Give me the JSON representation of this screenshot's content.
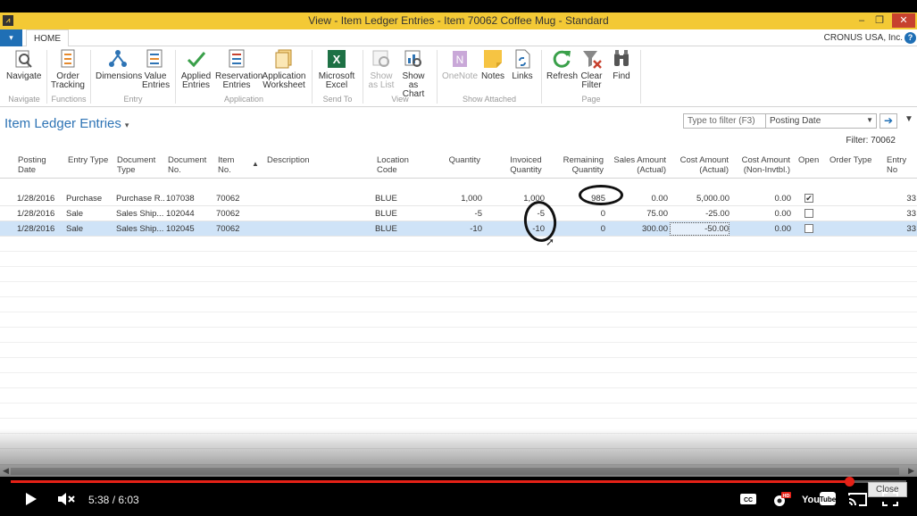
{
  "window": {
    "title": "View - Item Ledger Entries - Item 70062 Coffee Mug - Standard",
    "logo_icon": "dynamics-logo-icon"
  },
  "tabs": {
    "file_label": "▾",
    "home_label": "HOME",
    "company": "CRONUS USA, Inc.",
    "help": "?"
  },
  "ribbon": {
    "buttons": [
      {
        "label1": "Navigate",
        "label2": "",
        "icon": "navigate-icon"
      },
      {
        "label1": "Order",
        "label2": "Tracking",
        "icon": "order-tracking-icon"
      },
      {
        "label1": "Dimensions",
        "label2": "",
        "icon": "dimensions-icon"
      },
      {
        "label1": "Value",
        "label2": "Entries",
        "icon": "value-entries-icon"
      },
      {
        "label1": "Applied",
        "label2": "Entries",
        "icon": "checkmark-icon"
      },
      {
        "label1": "Reservation",
        "label2": "Entries",
        "icon": "reservation-entries-icon"
      },
      {
        "label1": "Application",
        "label2": "Worksheet",
        "icon": "application-worksheet-icon"
      },
      {
        "label1": "Microsoft",
        "label2": "Excel",
        "icon": "excel-icon"
      },
      {
        "label1": "Show",
        "label2": "as List",
        "icon": "show-as-list-icon"
      },
      {
        "label1": "Show as",
        "label2": "Chart",
        "icon": "show-as-chart-icon"
      },
      {
        "label1": "OneNote",
        "label2": "",
        "icon": "onenote-icon"
      },
      {
        "label1": "Notes",
        "label2": "",
        "icon": "notes-icon"
      },
      {
        "label1": "Links",
        "label2": "",
        "icon": "links-icon"
      },
      {
        "label1": "Refresh",
        "label2": "",
        "icon": "refresh-icon"
      },
      {
        "label1": "Clear",
        "label2": "Filter",
        "icon": "clear-filter-icon"
      },
      {
        "label1": "Find",
        "label2": "",
        "icon": "find-icon"
      }
    ],
    "groups": [
      "Navigate",
      "Functions",
      "Entry",
      "Application",
      "Send To",
      "View",
      "Show Attached",
      "Page"
    ]
  },
  "page": {
    "title": "Item Ledger Entries",
    "title_caret": "▾",
    "filter_placeholder": "Type to filter (F3)",
    "filter_field": "Posting Date",
    "filter_info": "Filter: 70062"
  },
  "grid": {
    "headers": {
      "posting_date": [
        "Posting",
        "Date"
      ],
      "entry_type": [
        "Entry Type",
        ""
      ],
      "document_type": [
        "Document",
        "Type"
      ],
      "document_no": [
        "Document",
        "No."
      ],
      "item_no": [
        "Item",
        "No."
      ],
      "description": [
        "Description",
        ""
      ],
      "location_code": [
        "Location",
        "Code"
      ],
      "quantity": [
        "Quantity",
        ""
      ],
      "invoiced_quantity": [
        "Invoiced",
        "Quantity"
      ],
      "remaining_quantity": [
        "Remaining",
        "Quantity"
      ],
      "sales_amount": [
        "Sales Amount",
        "(Actual)"
      ],
      "cost_amount": [
        "Cost Amount",
        "(Actual)"
      ],
      "cost_amount_non": [
        "Cost Amount",
        "(Non-Invtbl.)"
      ],
      "open": [
        "Open",
        ""
      ],
      "order_type": [
        "Order Type",
        ""
      ],
      "entry_no": [
        "Entry No",
        ""
      ]
    },
    "rows": [
      {
        "posting_date": "1/28/2016",
        "entry_type": "Purchase",
        "document_type": "Purchase R...",
        "document_no": "107038",
        "item_no": "70062",
        "location_code": "BLUE",
        "quantity": "1,000",
        "invoiced_quantity": "1,000",
        "remaining_quantity": "985",
        "sales_amount": "0.00",
        "cost_amount": "5,000.00",
        "cost_amount_non": "0.00",
        "open": true,
        "entry_no": "33"
      },
      {
        "posting_date": "1/28/2016",
        "entry_type": "Sale",
        "document_type": "Sales Ship...",
        "document_no": "102044",
        "item_no": "70062",
        "location_code": "BLUE",
        "quantity": "-5",
        "invoiced_quantity": "-5",
        "remaining_quantity": "0",
        "sales_amount": "75.00",
        "cost_amount": "-25.00",
        "cost_amount_non": "0.00",
        "open": false,
        "entry_no": "33"
      },
      {
        "posting_date": "1/28/2016",
        "entry_type": "Sale",
        "document_type": "Sales Ship...",
        "document_no": "102045",
        "item_no": "70062",
        "location_code": "BLUE",
        "quantity": "-10",
        "invoiced_quantity": "-10",
        "remaining_quantity": "0",
        "sales_amount": "300.00",
        "cost_amount": "-50.00",
        "cost_amount_non": "0.00",
        "open": false,
        "entry_no": "33"
      }
    ],
    "selected_row": 2
  },
  "video": {
    "time": "5:38 / 6:03",
    "progress_fraction": 0.936,
    "close_label": "Close",
    "hd_badge": "HD",
    "youtube_label": "YouTube"
  },
  "colors": {
    "titlebar": "#f3c935",
    "accent": "#2e74b5",
    "selected_row": "#cfe3f7",
    "video_progress": "#e62117"
  }
}
